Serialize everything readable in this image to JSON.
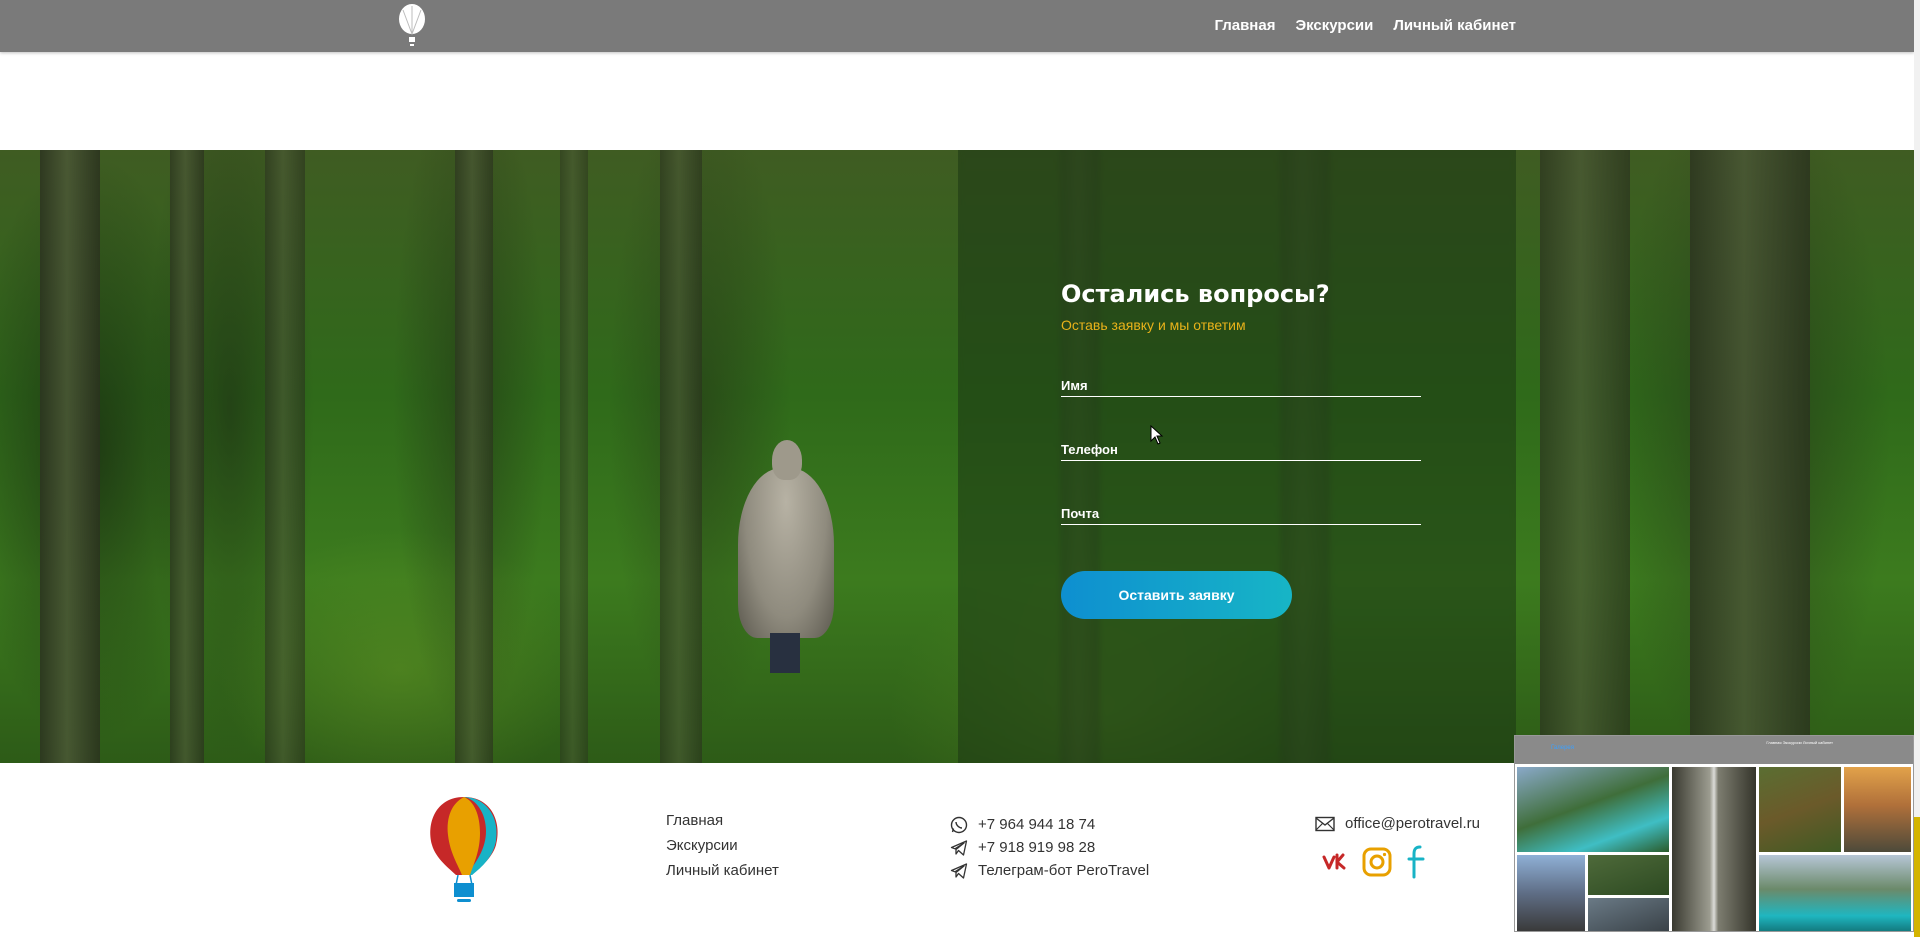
{
  "nav": {
    "items": [
      "Главная",
      "Экскурсии",
      "Личный кабинет"
    ]
  },
  "form": {
    "title": "Остались вопросы?",
    "subtitle": "Оставь заявку и мы ответим",
    "name_placeholder": "Имя",
    "phone_placeholder": "Телефон",
    "email_placeholder": "Почта",
    "submit_label": "Оставить заявку"
  },
  "footer": {
    "links": [
      "Главная",
      "Экскурсии",
      "Личный кабинет"
    ],
    "contacts": [
      {
        "icon": "whatsapp-icon",
        "text": "+7 964 944 18 74"
      },
      {
        "icon": "telegram-icon",
        "text": "+7 918 919 98 28"
      },
      {
        "icon": "telegram-icon",
        "text": "Телеграм-бот PeroTravel"
      }
    ],
    "email": "office@perotravel.ru",
    "socials": [
      "vk-icon",
      "instagram-icon",
      "facebook-icon"
    ]
  },
  "preview": {
    "mini_title": "Галерея",
    "mini_nav": "Главная   Экскурсии   Личный кабинет"
  },
  "colors": {
    "topbar": "#7a7a7a",
    "accent_orange": "#e8b21a",
    "button_start": "#0e8fd0",
    "button_end": "#17b5c6",
    "vk": "#c62828",
    "instagram": "#e8a000",
    "facebook": "#18b3c6"
  }
}
